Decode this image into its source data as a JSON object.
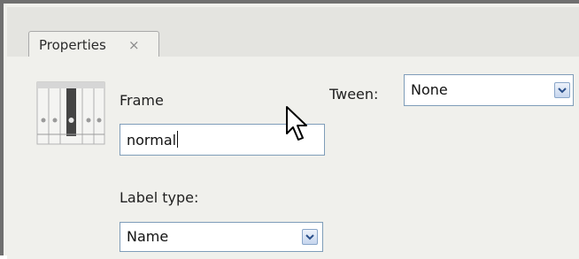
{
  "tab": {
    "label": "Properties",
    "close_glyph": "×"
  },
  "frame_section": {
    "heading": "Frame",
    "name_value": "normal",
    "label_type_label": "Label type:",
    "label_type_value": "Name"
  },
  "tween": {
    "label": "Tween:",
    "value": "None"
  },
  "icons": {
    "frame": "timeline-frame-icon",
    "dropdown": "chevron-down-icon",
    "cursor": "mouse-pointer-icon"
  }
}
